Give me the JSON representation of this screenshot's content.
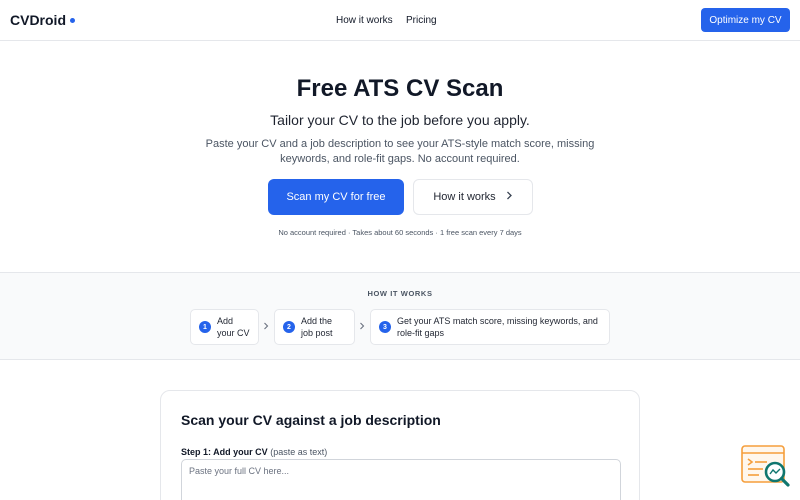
{
  "header": {
    "brand": "CVDroid",
    "nav": [
      {
        "label": "How it works"
      },
      {
        "label": "Pricing"
      }
    ],
    "cta_label": "Optimize my CV"
  },
  "hero": {
    "title": "Free ATS CV Scan",
    "subtitle": "Tailor your CV to the job before you apply.",
    "description": "Paste your CV and a job description to see your ATS-style match score, missing keywords, and role-fit gaps. No account required.",
    "primary_button": "Scan my CV for free",
    "secondary_button": "How it works",
    "note": "No account required · Takes about 60 seconds · 1 free scan every 7 days"
  },
  "how_it_works": {
    "heading": "HOW IT WORKS",
    "steps": [
      {
        "number": "1",
        "text": "Add your CV"
      },
      {
        "number": "2",
        "text": "Add the job post"
      },
      {
        "number": "3",
        "text": "Get your ATS match score, missing keywords, and role-fit gaps"
      }
    ]
  },
  "scan_card": {
    "title": "Scan your CV against a job description",
    "step1_label": "Step 1: Add your CV",
    "step1_hint": "(paste as text)",
    "cv_input_value": "",
    "cv_input_placeholder": "Paste your full CV here..."
  },
  "icons": {
    "brand_dot": "dot-icon",
    "how_chevron": "chevron-right-icon",
    "step_separator": "chevron-right-icon",
    "widget": "document-search-icon"
  },
  "colors": {
    "accent": "#2563eb",
    "widget_orange": "#f59e3b",
    "widget_teal": "#0f766e"
  }
}
